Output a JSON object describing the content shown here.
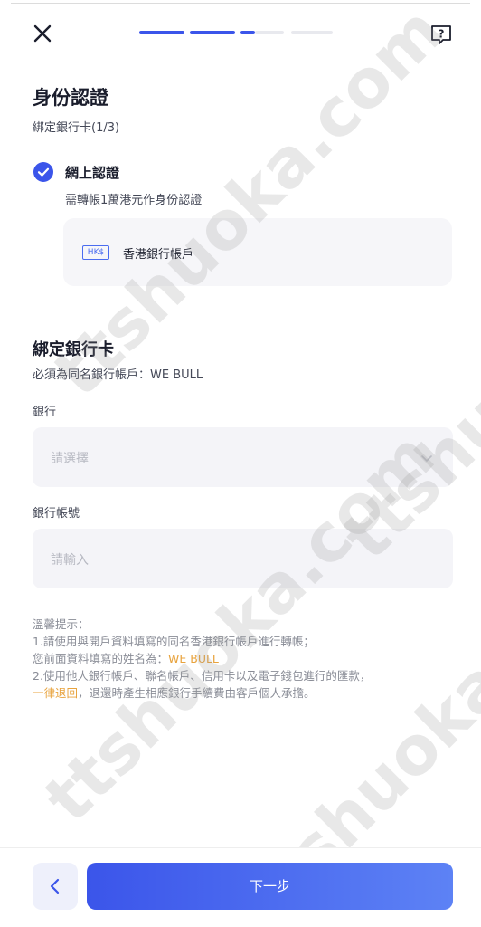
{
  "header": {
    "progress_steps": [
      {
        "state": "done"
      },
      {
        "state": "done"
      },
      {
        "state": "current"
      },
      {
        "state": "pending"
      },
      {
        "state": "pending"
      }
    ],
    "close_icon": "close-icon",
    "help_icon": "help-icon"
  },
  "page": {
    "title": "身份認證",
    "subtitle": "綁定銀行卡(1/3)"
  },
  "method": {
    "title": "網上認證",
    "description": "需轉帳1萬港元作身份認證",
    "bank_card": {
      "badge": "HK$",
      "label": "香港銀行帳戶"
    }
  },
  "bind": {
    "title": "綁定銀行卡",
    "subtitle": "必須為同名銀行帳戶：WE  BULL",
    "bank_field": {
      "label": "銀行",
      "placeholder": "請選擇"
    },
    "account_field": {
      "label": "銀行帳號",
      "placeholder": "請輸入"
    }
  },
  "tips": {
    "heading": "溫馨提示：",
    "line1": "1.請使用與開戶資料填寫的同名香港銀行帳戶進行轉帳；",
    "line2_prefix": "您前面資料填寫的姓名為：",
    "line2_name": "WE  BULL",
    "line3": "2.使用他人銀行帳戶、聯名帳戶、信用卡以及電子錢包進行的匯款，",
    "line4_highlight": "一律退回",
    "line4_rest": "，退還時產生相應銀行手續費由客戶個人承擔。"
  },
  "footer": {
    "next_label": "下一步"
  },
  "watermark": {
    "text": "ttshuoka.com"
  },
  "colors": {
    "accent": "#3b55ea",
    "progress_done": "#3b55ea",
    "progress_pending": "#e8e9ee",
    "highlight": "#e8a33d"
  }
}
